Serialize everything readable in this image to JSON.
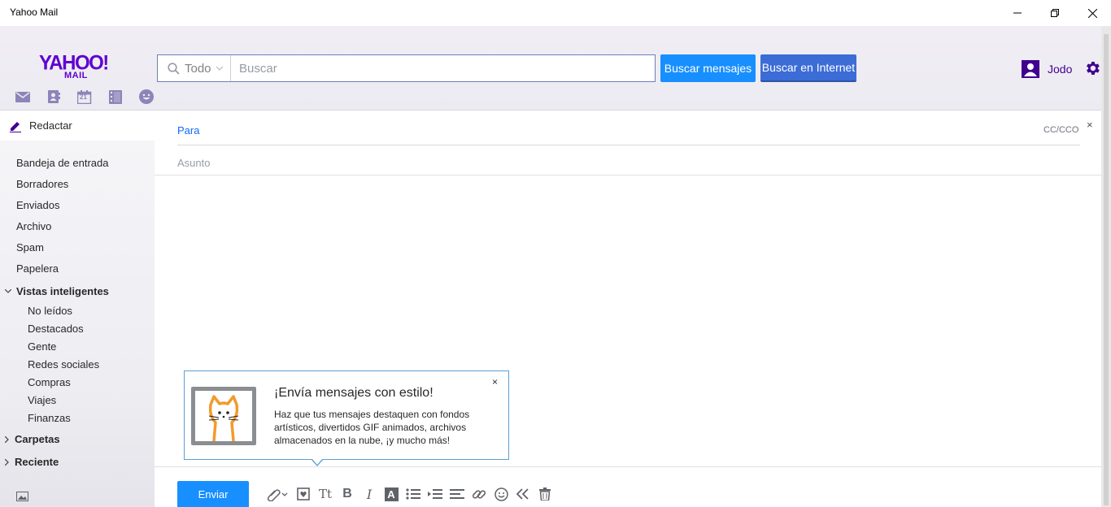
{
  "window": {
    "title": "Yahoo Mail"
  },
  "header": {
    "logo_top": "YAHOO!",
    "logo_bottom": "MAIL",
    "app_icons": [
      "mail-icon",
      "contacts-icon",
      "calendar-icon",
      "notepad-icon",
      "messenger-icon"
    ],
    "calendar_day": "21",
    "search": {
      "scope": "Todo",
      "placeholder": "Buscar"
    },
    "search_mail_label": "Buscar mensajes",
    "search_web_label": "Buscar en Internet",
    "user_name": "Jodo"
  },
  "sidebar": {
    "compose_label": "Redactar",
    "folders": [
      "Bandeja de entrada",
      "Borradores",
      "Enviados",
      "Archivo",
      "Spam",
      "Papelera"
    ],
    "smart_views_label": "Vistas inteligentes",
    "smart_views": [
      "No leídos",
      "Destacados",
      "Gente",
      "Redes sociales",
      "Compras",
      "Viajes",
      "Finanzas"
    ],
    "folders_label": "Carpetas",
    "recent_label": "Reciente"
  },
  "compose": {
    "to_label": "Para",
    "cc_label": "CC/CCO",
    "close": "×",
    "subject_placeholder": "Asunto",
    "popup": {
      "title": "¡Envía mensajes con estilo!",
      "body": "Haz que tus mensajes destaquen con fondos artísticos, divertidos GIF animados, archivos almacenados en la nube, ¡y mucho más!",
      "close": "×"
    },
    "send_label": "Enviar",
    "toolbar_icons": [
      "attach-icon",
      "stationery-icon",
      "font-size-icon",
      "bold-icon",
      "italic-icon",
      "text-color-icon",
      "bullet-list-icon",
      "indent-icon",
      "align-icon",
      "link-icon",
      "emoji-icon",
      "plain-text-icon",
      "delete-icon"
    ],
    "toolbar_glyphs": {
      "font_size": "Tt",
      "bold": "B",
      "italic": "I",
      "text_color": "A"
    }
  },
  "colors": {
    "brand": "#6001d2",
    "accent": "#188fff",
    "link": "#0f69ff"
  }
}
